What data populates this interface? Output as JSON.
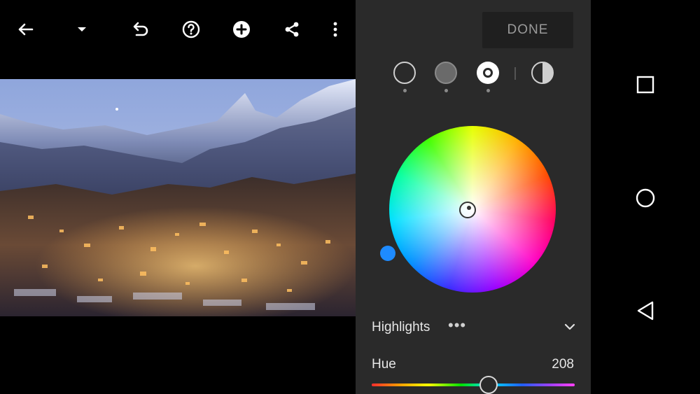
{
  "toolbar": {
    "back_icon": "arrow-left-icon",
    "dropdown_icon": "caret-down-icon",
    "undo_icon": "undo-icon",
    "help_icon": "help-circle-icon",
    "add_icon": "add-circle-icon",
    "share_icon": "share-icon",
    "more_icon": "more-vertical-icon"
  },
  "photo": {
    "description_icon": "mountain-village-photo"
  },
  "panel": {
    "done_label": "DONE",
    "zones": [
      {
        "name": "shadows",
        "fill": "#2a2a2a",
        "selected": false
      },
      {
        "name": "midtones",
        "fill": "#6a6a6a",
        "selected": false
      },
      {
        "name": "highlights",
        "fill": "#ffffff",
        "selected": true
      },
      {
        "name": "all",
        "fill": "split",
        "selected": false
      }
    ],
    "region_label": "Highlights",
    "region_more": "•••",
    "hue_label": "Hue",
    "hue_value": "208",
    "accent_color": "#1e8bff"
  },
  "nav": {
    "recents_icon": "square-icon",
    "home_icon": "circle-icon",
    "back_icon": "triangle-back-icon"
  }
}
